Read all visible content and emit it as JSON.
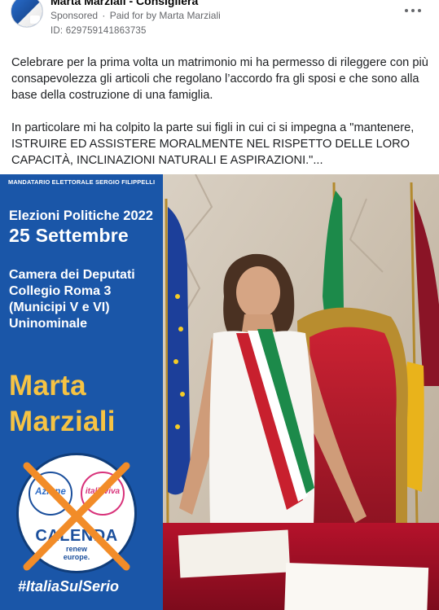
{
  "post": {
    "page_name": "Marta Marziali - Consigliera",
    "sponsored": "Sponsored",
    "separator": "·",
    "paid_for": "Paid for by Marta Marziali",
    "ad_id": "ID: 629759141863735",
    "more_icon": "more-horizontal-icon"
  },
  "body": {
    "paragraph_1": "Celebrare per la prima volta un matrimonio mi ha permesso di rileggere con più consapevolezza gli articoli che regolano l’accordo fra gli sposi e che sono alla base della costruzione di una famiglia.",
    "paragraph_2": "In particolare mi ha colpito la parte sui figli in cui ci si impegna a \"mantenere, ISTRUIRE ED ASSISTERE MORALMENTE NEL RISPETTO DELLE LORO CAPACITÀ, INCLINAZIONI NATURALI E ASPIRAZIONI.\"..."
  },
  "creative": {
    "mandatario": "MANDATARIO ELETTORALE SERGIO FILIPPELLI",
    "elezioni": "Elezioni Politiche 2022",
    "date": "25 Settembre",
    "camera_lines": [
      "Camera dei Deputati",
      "Collegio Roma 3",
      "(Municipi V e VI)",
      "Uninominale"
    ],
    "candidate_first": "Marta",
    "candidate_last": "Marziali",
    "logo": {
      "azione": "Azione",
      "italiaviva": "italiaviva",
      "calenda": "CALENDA",
      "renew_1": "renew",
      "renew_2": "europe."
    },
    "hashtag": "#ItaliaSulSerio",
    "colors": {
      "panel_blue": "#1a56a8",
      "candidate_yellow": "#f6c343",
      "cross_orange": "#f28c28"
    }
  }
}
